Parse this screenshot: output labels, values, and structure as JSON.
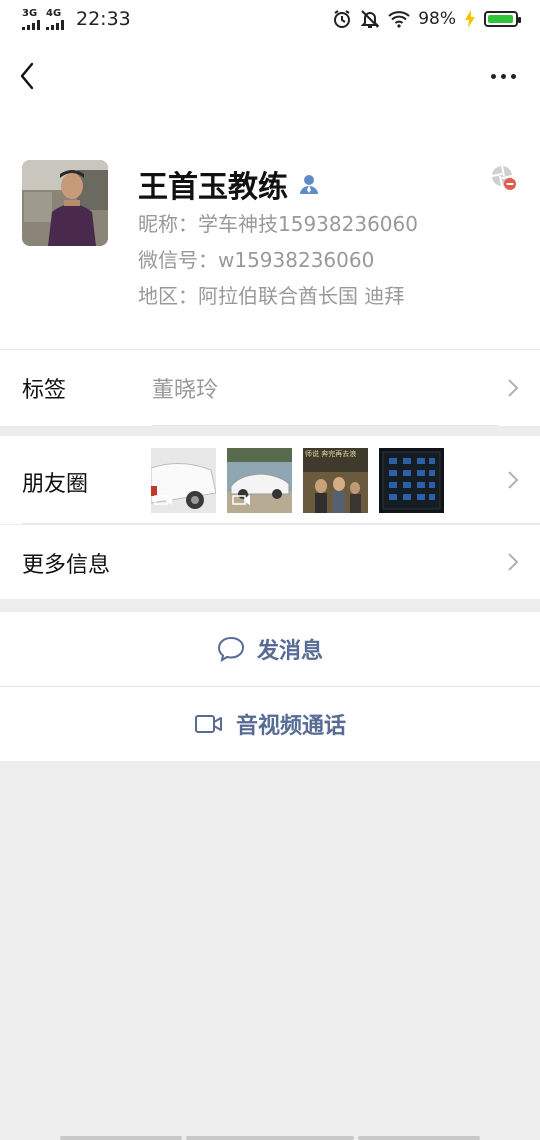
{
  "status_bar": {
    "signal1_label": "3G",
    "signal2_label": "4G",
    "time": "22:33",
    "battery_percent": "98%",
    "battery_level": 0.98
  },
  "profile": {
    "name": "王首玉教练",
    "nickname_line": "昵称：学车神技15938236060",
    "wechat_id_line": "微信号：w15938236060",
    "region_line": "地区：阿拉伯联合酋长国  迪拜"
  },
  "tags_row": {
    "title": "标签",
    "value": "董晓玲"
  },
  "moments_row": {
    "title": "朋友圈",
    "thumb_text": "师说 奔完再去浪"
  },
  "more_info_row": {
    "title": "更多信息"
  },
  "actions": {
    "message_label": "发消息",
    "call_label": "音视频通话"
  },
  "colors": {
    "accent": "#576b95",
    "background": "#ededed",
    "battery_green": "#2fc43a"
  },
  "icons": [
    "back-arrow-icon",
    "more-dots-icon",
    "contact-person-icon",
    "blocked-moments-icon",
    "chevron-right-icon",
    "chat-bubble-icon",
    "video-camera-icon",
    "alarm-icon",
    "mute-bell-icon",
    "wifi-icon",
    "battery-icon",
    "charging-bolt-icon"
  ]
}
